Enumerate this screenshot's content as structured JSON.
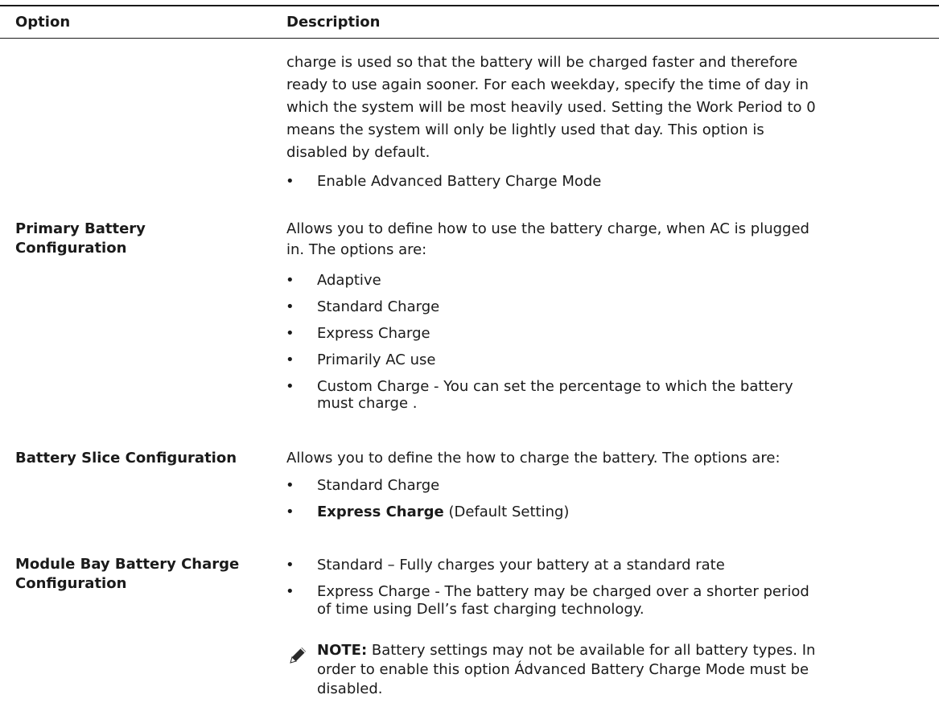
{
  "table": {
    "headers": {
      "option": "Option",
      "description": "Description"
    }
  },
  "rows": {
    "continued": {
      "lines": [
        "charge is used so that the battery will be charged faster and therefore",
        "ready to use again sooner. For each weekday, specify the time of day in",
        "which the system will be most heavily used. Setting the Work Period to 0",
        "means the system will only be lightly used that day. This option is",
        "disabled by default."
      ],
      "bullet": "Enable Advanced Battery Charge Mode"
    },
    "primary_battery": {
      "option_lines": [
        "Primary Battery",
        "Configuration"
      ],
      "desc_lines": [
        "Allows you to define how to use the battery charge, when AC is plugged",
        "in. The options are:"
      ],
      "bullets": [
        "Adaptive",
        "Standard Charge",
        "Express Charge",
        "Primarily AC use",
        "Custom Charge - You can set the percentage to which the battery",
        "must charge ."
      ]
    },
    "battery_slice": {
      "option": "Battery Slice Configuration",
      "desc": "Allows you to define the how to charge the battery. The options are:",
      "bullet_1": "Standard Charge",
      "bullet_2_bold": "Express Charge",
      "bullet_2_rest": " (Default Setting)"
    },
    "module_bay": {
      "option_lines": [
        "Module Bay Battery Charge",
        "Configuration"
      ],
      "bullet_1": "Standard – Fully charges your battery at a standard rate",
      "bullet_2_lines": [
        "Express Charge - The battery may be charged over a shorter period",
        "of time using Dell’s fast charging technology."
      ],
      "note_label": "NOTE:",
      "note_lines": [
        " Battery settings may not be available for all battery types. In",
        "order to enable this option Ádvanced Battery Charge Mode must be",
        "disabled."
      ]
    }
  },
  "icons": {
    "note": "pencil-note-icon"
  }
}
